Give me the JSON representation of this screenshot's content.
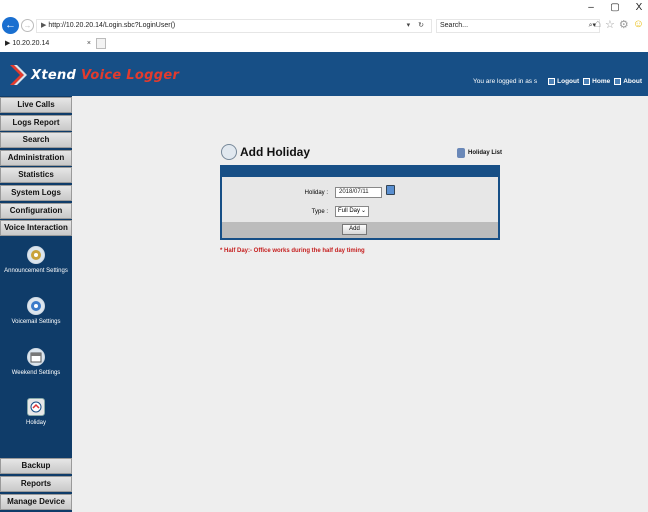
{
  "browser": {
    "url": "http://10.20.20.14/Login.sbc?LoginUser()",
    "search_placeholder": "Search...",
    "tab_title": "10.20.20.14",
    "minimize": "–",
    "maximize": "▢",
    "close": "X"
  },
  "header": {
    "logo_word1": "Xtend",
    "logo_word2": "Voice Logger",
    "logged_in_text": "You are logged in as s",
    "links": [
      "Logout",
      "Home",
      "About"
    ]
  },
  "sidebar": {
    "top_items": [
      "Live Calls",
      "Logs Report",
      "Search",
      "Administration",
      "Statistics",
      "System Logs",
      "Configuration",
      "Voice Interaction"
    ],
    "sub_items": [
      "Announcement Settings",
      "Voicemail Settings",
      "Weekend Settings",
      "Holiday"
    ],
    "active_sub_item": "Holiday",
    "bottom_items": [
      "Backup",
      "Reports",
      "Manage Device"
    ]
  },
  "main": {
    "title": "Add Holiday",
    "holiday_list_link": "Holiday List",
    "form": {
      "holiday_label": "Holiday :",
      "holiday_value": "2018/07/11",
      "type_label": "Type :",
      "type_value": "Full Day",
      "add_button": "Add"
    },
    "note": "* Half Day:- Office works during the half day timing"
  },
  "colors": {
    "header_blue": "#174f86",
    "sidebar_blue": "#0f3c69",
    "note_red": "#c51d1d",
    "logo_red": "#e23b2e"
  }
}
